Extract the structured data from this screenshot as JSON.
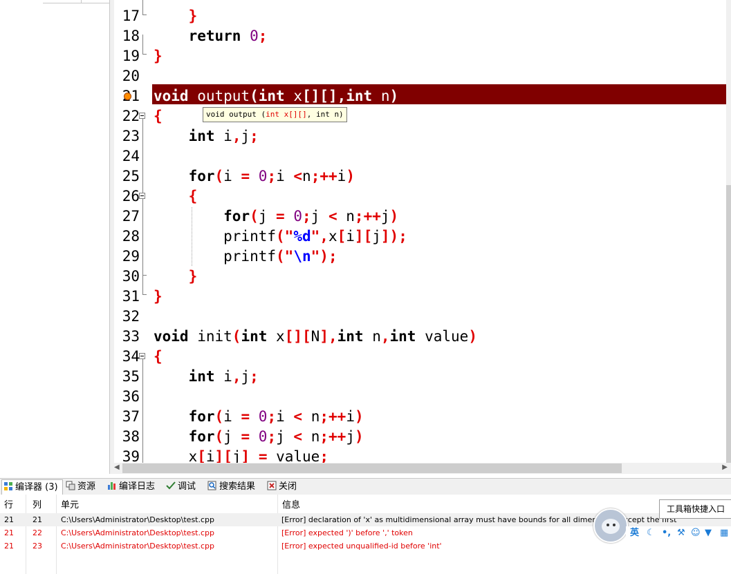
{
  "editor": {
    "lines": [
      {
        "num": "17",
        "code": "    }"
      },
      {
        "num": "18",
        "code": "    return 0;"
      },
      {
        "num": "19",
        "code": "}"
      },
      {
        "num": "20",
        "code": ""
      },
      {
        "num": "21",
        "code": "void output(int x[][],int n)"
      },
      {
        "num": "22",
        "code": "{"
      },
      {
        "num": "23",
        "code": "    int i,j;"
      },
      {
        "num": "24",
        "code": ""
      },
      {
        "num": "25",
        "code": "    for(i = 0;i <n;++i)"
      },
      {
        "num": "26",
        "code": "    {"
      },
      {
        "num": "27",
        "code": "        for(j = 0;j < n;++j)"
      },
      {
        "num": "28",
        "code": "        printf(\"%d\",x[i][j]);"
      },
      {
        "num": "29",
        "code": "        printf(\"\\n\");"
      },
      {
        "num": "30",
        "code": "    }"
      },
      {
        "num": "31",
        "code": "}"
      },
      {
        "num": "32",
        "code": ""
      },
      {
        "num": "33",
        "code": "void init(int x[][N],int n,int value)"
      },
      {
        "num": "34",
        "code": "{"
      },
      {
        "num": "35",
        "code": "    int i,j;"
      },
      {
        "num": "36",
        "code": ""
      },
      {
        "num": "37",
        "code": "    for(i = 0;i < n;++i)"
      },
      {
        "num": "38",
        "code": "    for(j = 0;j < n;++j)"
      },
      {
        "num": "39",
        "code": "    x[i][j] = value;"
      }
    ],
    "highlighted_line": "21",
    "tooltip": "void output (int x[][], int n)"
  },
  "tabs": [
    {
      "label": "编译器 (3)",
      "icon": "compiler-icon"
    },
    {
      "label": "资源",
      "icon": "resources-icon"
    },
    {
      "label": "编译日志",
      "icon": "chart-icon"
    },
    {
      "label": "调试",
      "icon": "checkmark-icon"
    },
    {
      "label": "搜索结果",
      "icon": "search-icon"
    },
    {
      "label": "关闭",
      "icon": "close-icon"
    }
  ],
  "messages": {
    "headers": {
      "line": "行",
      "col": "列",
      "unit": "单元",
      "info": "信息"
    },
    "rows": [
      {
        "line": "21",
        "col": "21",
        "unit": "C:\\Users\\Administrator\\Desktop\\test.cpp",
        "info": "[Error] declaration of 'x' as multidimensional array must have bounds for all dimensions except the first"
      },
      {
        "line": "21",
        "col": "22",
        "unit": "C:\\Users\\Administrator\\Desktop\\test.cpp",
        "info": "[Error] expected ')' before ',' token"
      },
      {
        "line": "21",
        "col": "23",
        "unit": "C:\\Users\\Administrator\\Desktop\\test.cpp",
        "info": "[Error] expected unqualified-id before 'int'"
      }
    ]
  },
  "ime": {
    "tip": "工具箱快捷入口",
    "lang": "英",
    "icons": [
      "moon-icon",
      "punctuation-icon",
      "wrench-icon",
      "emoji-icon",
      "shirt-icon",
      "grid-icon"
    ]
  },
  "colors": {
    "highlight": "#800000",
    "keyword_symbol": "#e00000",
    "number": "#800080",
    "string": "#0000ff"
  }
}
